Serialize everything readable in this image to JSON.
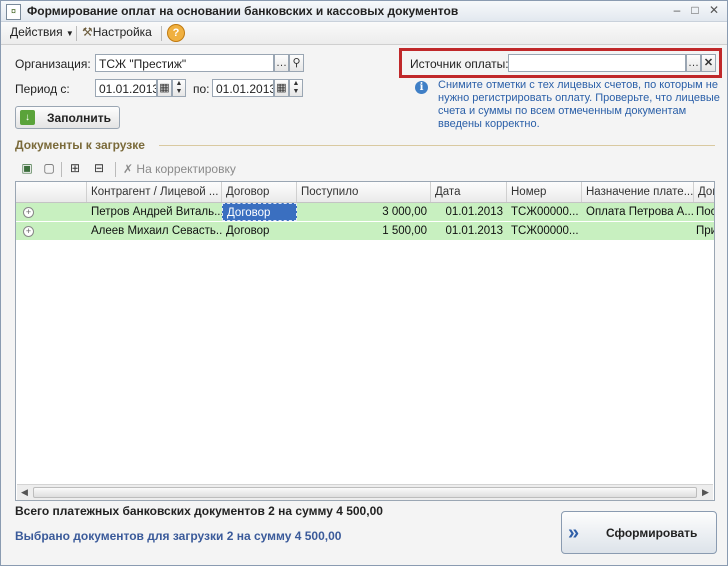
{
  "window": {
    "title": "Формирование оплат на основании банковских и кассовых документов"
  },
  "toolbar": {
    "actions_label": "Действия",
    "settings_label": "Настройка",
    "help": "?"
  },
  "form": {
    "org_label": "Организация:",
    "org_value": "ТСЖ \"Престиж\"",
    "period_from_label": "Период с:",
    "period_from_value": "01.01.2013",
    "period_to_label": "по:",
    "period_to_value": "01.01.2013",
    "source_label": "Источник оплаты:",
    "source_value": "",
    "fill_button": "Заполнить"
  },
  "info": {
    "text": "Снимите отметки с тех лицевых счетов, по которым не нужно регистрировать оплату. Проверьте, что лицевые счета и суммы по всем отмеченным документам введены корректно."
  },
  "documents": {
    "section_title": "Документы к загрузке",
    "correct_button": "На корректировку",
    "columns": [
      "Контрагент / Лицевой ...",
      "Договор",
      "Поступило",
      "Дата",
      "Номер",
      "Назначение плате...",
      "Док"
    ],
    "rows": [
      {
        "contractor": "Петров Андрей Виталь...",
        "contract": "Договор",
        "amount": "3 000,00",
        "date": "01.01.2013",
        "number": "ТСЖ00000...",
        "purpose": "Оплата Петрова А...",
        "doc": "Пос"
      },
      {
        "contractor": "Алеев Михаил Севасть...",
        "contract": "Договор",
        "amount": "1 500,00",
        "date": "01.01.2013",
        "number": "ТСЖ00000...",
        "purpose": "",
        "doc": "При"
      }
    ]
  },
  "totals": {
    "bank_docs": "Всего платежных банковских документов 2 на сумму 4 500,00",
    "selected": "Выбрано документов для загрузки 2 на сумму 4 500,00"
  },
  "generate_button": "Сформировать",
  "colors": {
    "row_bg": "#c8f0c0",
    "highlight_border": "#c0282a",
    "info_text": "#2a5fa8",
    "selected_cell": "#3a6fc0"
  }
}
